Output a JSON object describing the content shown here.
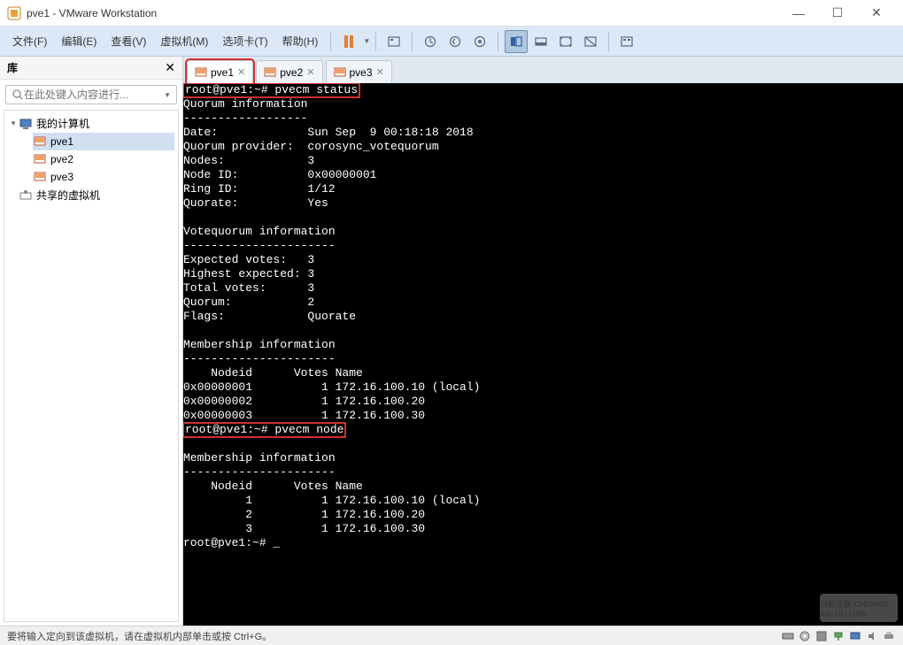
{
  "window": {
    "title": "pve1 - VMware Workstation"
  },
  "menus": {
    "file": "文件(F)",
    "edit": "编辑(E)",
    "view": "查看(V)",
    "vm": "虚拟机(M)",
    "tabs": "选项卡(T)",
    "help": "帮助(H)"
  },
  "sidebar": {
    "heading": "库",
    "search_placeholder": "在此处键入内容进行...",
    "tree": {
      "root": "我的计算机",
      "items": [
        "pve1",
        "pve2",
        "pve3"
      ],
      "shared": "共享的虚拟机"
    }
  },
  "tabs": [
    "pve1",
    "pve2",
    "pve3"
  ],
  "console": {
    "prompt1": "root@pve1:~# pvecm status",
    "line_quorum_info": "Quorum information",
    "line_dashes1": "------------------",
    "line_date": "Date:             Sun Sep  9 00:18:18 2018",
    "line_qp": "Quorum provider:  corosync_votequorum",
    "line_nodes": "Nodes:            3",
    "line_nodeid": "Node ID:          0x00000001",
    "line_ringid": "Ring ID:          1/12",
    "line_quorate": "Quorate:          Yes",
    "line_vq_info": "Votequorum information",
    "line_dashes2": "----------------------",
    "line_ev": "Expected votes:   3",
    "line_he": "Highest expected: 3",
    "line_tv": "Total votes:      3",
    "line_q": "Quorum:           2",
    "line_flags": "Flags:            Quorate",
    "line_mem_info1": "Membership information",
    "line_dashes3": "----------------------",
    "line_hdr1": "    Nodeid      Votes Name",
    "line_m1": "0x00000001          1 172.16.100.10 (local)",
    "line_m2": "0x00000002          1 172.16.100.20",
    "line_m3": "0x00000003          1 172.16.100.30",
    "prompt2": "root@pve1:~# pvecm node",
    "line_mem_info2": "Membership information",
    "line_dashes4": "----------------------",
    "line_hdr2": "    Nodeid      Votes Name",
    "line_n1": "         1          1 172.16.100.10 (local)",
    "line_n2": "         2          1 172.16.100.20",
    "line_n3": "         3          1 172.16.100.30",
    "prompt3": "root@pve1:~# _"
  },
  "status": {
    "message": "要将输入定向到该虚拟机，请在虚拟机内部单击或按 Ctrl+G。"
  },
  "watermark": "创新互联 CHUANG XIN HU LIAN"
}
